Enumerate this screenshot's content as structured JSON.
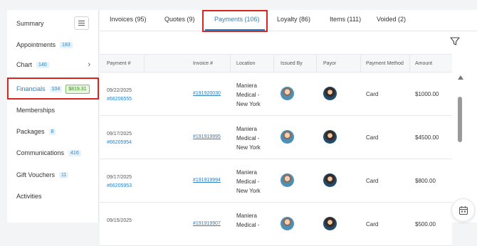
{
  "sidebar": {
    "items": [
      {
        "label": "Summary",
        "badge": ""
      },
      {
        "label": "Appointments",
        "badge": "183"
      },
      {
        "label": "Chart",
        "badge": "140"
      },
      {
        "label": "Financials",
        "badge": "104",
        "amount": "$819.31"
      },
      {
        "label": "Memberships",
        "badge": ""
      },
      {
        "label": "Packages",
        "badge": "8"
      },
      {
        "label": "Communications",
        "badge": "416"
      },
      {
        "label": "Gift Vouchers",
        "badge": "11"
      },
      {
        "label": "Activities",
        "badge": ""
      }
    ]
  },
  "tabs": [
    {
      "label": "Invoices (95)"
    },
    {
      "label": "Quotes (9)"
    },
    {
      "label": "Payments (106)"
    },
    {
      "label": "Loyalty (86)"
    },
    {
      "label": "Items (111)"
    },
    {
      "label": "Voided (2)"
    }
  ],
  "table": {
    "headers": [
      "Payment #",
      "Invoice #",
      "Location",
      "Issued By",
      "Payor",
      "Payment Method",
      "Amount"
    ],
    "rows": [
      {
        "date": "09/22/2025",
        "payment_id": "#66206555",
        "invoice": "#191920030",
        "location_1": "Maniera",
        "location_2": "Medical -",
        "location_3": "New York",
        "method": "Card",
        "amount": "$1000.00"
      },
      {
        "date": "09/17/2025",
        "payment_id": "#66205954",
        "invoice": "#191919995",
        "location_1": "Maniera",
        "location_2": "Medical -",
        "location_3": "New York",
        "method": "Card",
        "amount": "$4500.00"
      },
      {
        "date": "09/17/2025",
        "payment_id": "#66205953",
        "invoice": "#191919994",
        "location_1": "Maniera",
        "location_2": "Medical -",
        "location_3": "New York",
        "method": "Card",
        "amount": "$800.00"
      },
      {
        "date": "09/15/2025",
        "payment_id": "",
        "invoice": "#191919907",
        "location_1": "Maniera",
        "location_2": "Medical -",
        "location_3": "",
        "method": "Card",
        "amount": "$500.00"
      }
    ]
  },
  "colors": {
    "accent": "#2a7fc5",
    "highlight_box": "#d9261c",
    "money_badge": "#3b8a22"
  },
  "icons": {
    "menu": "hamburger-icon",
    "chevron": "chevron-right-icon",
    "filter": "filter-icon",
    "calendar": "calendar-icon"
  }
}
